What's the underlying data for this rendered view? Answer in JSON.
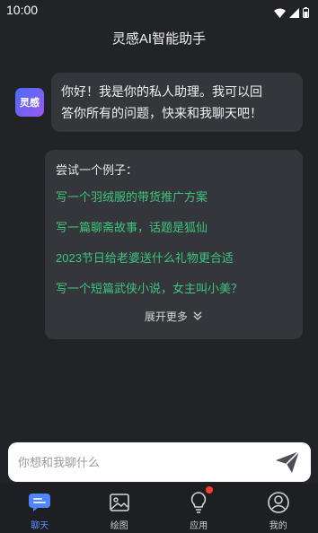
{
  "status_bar": {
    "time": "10:00"
  },
  "header": {
    "title": "灵感AI智能助手"
  },
  "avatar": {
    "label": "灵感"
  },
  "greeting": {
    "line1": "你好！我是你的私人助理。我可以回",
    "line2": "答你所有的问题，快来和我聊天吧！"
  },
  "examples": {
    "heading": "尝试一个例子：",
    "items": [
      {
        "text": "写一个羽绒服的带货推广方案"
      },
      {
        "text": "写一篇聊斋故事，话题是狐仙"
      },
      {
        "text": "2023节日给老婆送什么礼物更合适"
      },
      {
        "text": "写一个短篇武侠小说，女主叫小美？"
      }
    ],
    "expand_label": "展开更多"
  },
  "input": {
    "placeholder": "你想和我聊什么"
  },
  "nav": {
    "items": [
      {
        "label": "聊天",
        "icon": "chat-icon",
        "active": true
      },
      {
        "label": "绘图",
        "icon": "image-icon"
      },
      {
        "label": "应用",
        "icon": "lightbulb-icon",
        "badge": true
      },
      {
        "label": "我的",
        "icon": "user-icon"
      }
    ]
  },
  "colors": {
    "background": "#222327",
    "bubble": "#34363b",
    "example_text": "#3ec67c",
    "active_nav": "#5b8dff",
    "badge": "#ff3b30"
  }
}
